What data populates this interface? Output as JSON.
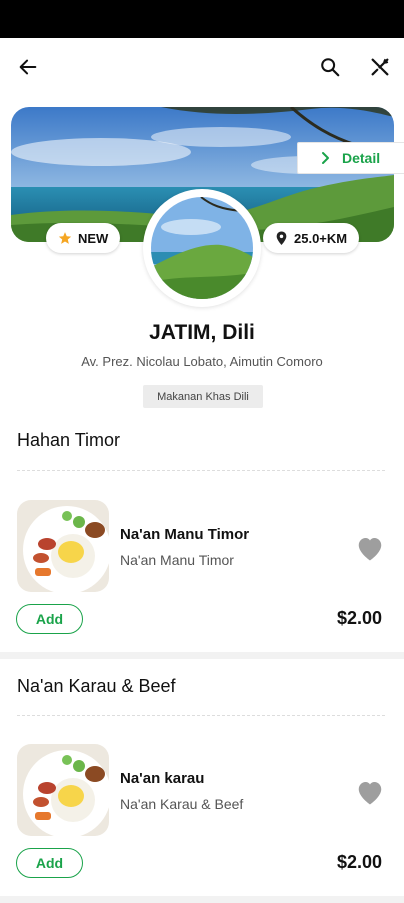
{
  "header": {
    "back_icon": "arrow-left-icon",
    "search_icon": "search-icon",
    "tools_icon": "fork-knife-icon"
  },
  "banner": {
    "detail_label": "Detail",
    "new_badge": "NEW",
    "distance": "25.0+KM"
  },
  "store": {
    "name": "JATIM, Dili",
    "address": "Av. Prez. Nicolau Lobato, Aimutin Comoro",
    "tag": "Makanan Khas Dili"
  },
  "sections": [
    {
      "title": "Hahan Timor",
      "item": {
        "name": "Na'an Manu Timor",
        "description": "Na'an Manu Timor",
        "price": "$2.00",
        "add_label": "Add"
      }
    },
    {
      "title": "Na'an Karau & Beef",
      "item": {
        "name": "Na'an karau",
        "description": "Na'an Karau & Beef",
        "price": "$2.00",
        "add_label": "Add"
      }
    }
  ],
  "colors": {
    "accent": "#1aa34a",
    "heart": "#9e9e9e",
    "star": "#f5a623"
  }
}
